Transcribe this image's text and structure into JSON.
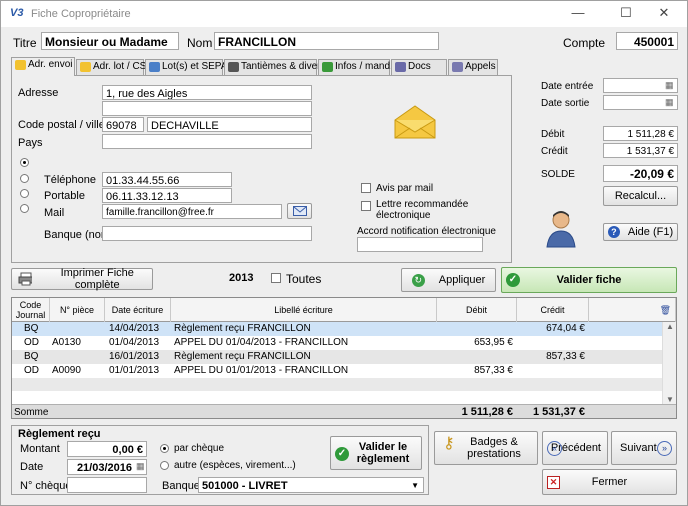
{
  "window": {
    "title": "Fiche Copropriétaire",
    "app_icon": "V3",
    "minimize": "—",
    "maximize": "☐",
    "close": "✕"
  },
  "header": {
    "titre_label": "Titre",
    "titre_value": "Monsieur ou Madame",
    "nom_label": "Nom",
    "nom_value": "FRANCILLON",
    "compte_label": "Compte",
    "compte_value": "450001"
  },
  "tabs": [
    {
      "label": "Adr. envoi",
      "color": "#f2c230"
    },
    {
      "label": "Adr. lot / CS",
      "color": "#f2c230"
    },
    {
      "label": "Lot(s) et SEPA",
      "color": "#4a7fc8"
    },
    {
      "label": "Tantièmes & divers",
      "color": "#555555"
    },
    {
      "label": "Infos / mand.",
      "color": "#3a9a3a"
    },
    {
      "label": "Docs",
      "color": "#6a6aa8"
    },
    {
      "label": "Appels",
      "color": "#7a7ab0"
    }
  ],
  "adresse": {
    "adresse_label": "Adresse",
    "adresse_line1": "1, rue des Aigles",
    "adresse_line2": "",
    "cp_label": "Code postal / ville",
    "cp_value": "69078",
    "ville_value": "DECHAVILLE",
    "pays_label": "Pays",
    "pays_value": "",
    "telephone_label": "Téléphone",
    "telephone_value": "01.33.44.55.66",
    "portable_label": "Portable",
    "portable_value": "06.11.33.12.13",
    "mail_label": "Mail",
    "mail_value": "famille.francillon@free.fr",
    "banque_label": "Banque (nom)",
    "banque_value": "",
    "avis_label": "Avis par mail",
    "lettre_label": "Lettre recommandée électronique",
    "accord_label": "Accord notification électronique",
    "accord_value": ""
  },
  "side": {
    "date_entree_label": "Date entrée",
    "date_entree_value": "",
    "date_sortie_label": "Date sortie",
    "date_sortie_value": "",
    "debit_label": "Débit",
    "debit_value": "1 511,28 €",
    "credit_label": "Crédit",
    "credit_value": "1 531,37 €",
    "solde_label": "SOLDE",
    "solde_value": "-20,09 €",
    "recalcul_label": "Recalcul...",
    "aide_label": "Aide (F1)"
  },
  "actions": {
    "imprimer_label": "Imprimer Fiche complète",
    "year": "2013",
    "toutes_label": "Toutes",
    "appliquer_label": "Appliquer",
    "valider_fiche_label": "Valider fiche"
  },
  "grid": {
    "columns": [
      "Code Journal",
      "N° pièce",
      "Date écriture",
      "Libellé écriture",
      "Débit",
      "Crédit"
    ],
    "rows": [
      {
        "journal": "BQ",
        "piece": "",
        "date": "14/04/2013",
        "libelle": "Règlement reçu FRANCILLON",
        "debit": "",
        "credit": "674,04 €"
      },
      {
        "journal": "OD",
        "piece": "A0130",
        "date": "01/04/2013",
        "libelle": "APPEL DU 01/04/2013 - FRANCILLON",
        "debit": "653,95 €",
        "credit": ""
      },
      {
        "journal": "BQ",
        "piece": "",
        "date": "16/01/2013",
        "libelle": "Règlement reçu FRANCILLON",
        "debit": "",
        "credit": "857,33 €"
      },
      {
        "journal": "OD",
        "piece": "A0090",
        "date": "01/01/2013",
        "libelle": "APPEL DU 01/01/2013 - FRANCILLON",
        "debit": "857,33 €",
        "credit": ""
      }
    ],
    "somme_label": "Somme",
    "somme_debit": "1 511,28 €",
    "somme_credit": "1 531,37 €"
  },
  "reglement": {
    "title": "Règlement reçu",
    "montant_label": "Montant",
    "montant_value": "0,00 €",
    "date_label": "Date",
    "date_value": "21/03/2016",
    "cheque_label": "N° chèque",
    "cheque_value": "",
    "par_cheque_label": "par chèque",
    "autre_label": "autre (espèces, virement...)",
    "banque_label": "Banque",
    "banque_value": "501000 - LIVRET",
    "valider_label_1": "Valider le",
    "valider_label_2": "règlement"
  },
  "bottom": {
    "badges_label_1": "Badges &",
    "badges_label_2": "prestations",
    "precedent_label": "Précédent",
    "suivant_label": "Suivant",
    "fermer_label": "Fermer"
  }
}
